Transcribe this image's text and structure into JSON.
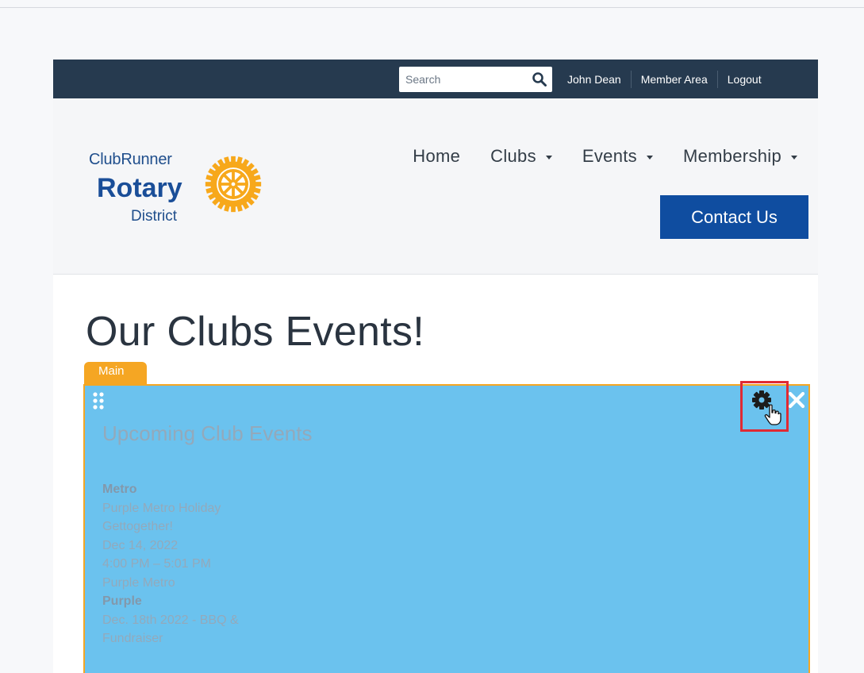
{
  "topbar": {
    "search_placeholder": "Search",
    "links": [
      "John Dean",
      "Member Area",
      "Logout"
    ]
  },
  "logo": {
    "line1": "ClubRunner",
    "line2": "Rotary",
    "line3": "District"
  },
  "nav": {
    "items": [
      {
        "label": "Home",
        "dropdown": false
      },
      {
        "label": "Clubs",
        "dropdown": true
      },
      {
        "label": "Events",
        "dropdown": true
      },
      {
        "label": "Membership",
        "dropdown": true
      }
    ],
    "contact_label": "Contact Us"
  },
  "page": {
    "title": "Our Clubs Events!"
  },
  "widget": {
    "tab_label": "Main",
    "title": "Upcoming Club Events",
    "events": [
      {
        "club": "Metro",
        "lines": [
          "Purple Metro Holiday",
          "Gettogether!",
          "Dec 14, 2022",
          "4:00 PM – 5:01 PM",
          "Purple Metro"
        ]
      },
      {
        "club": "Purple",
        "lines": [
          "Dec. 18th 2022 - BBQ &",
          "Fundraiser"
        ]
      }
    ]
  },
  "colors": {
    "topbar": "#263a4f",
    "contact_button": "#0f4da0",
    "widget_bg": "#6bc2ee",
    "tab_accent": "#f5a623",
    "highlight_box": "#e02a33",
    "rotary_gold": "#f7a81b"
  },
  "icons": [
    "search-icon",
    "rotary-wheel-logo",
    "drag-handle-icon",
    "gear-icon",
    "hand-cursor-icon",
    "close-icon"
  ]
}
